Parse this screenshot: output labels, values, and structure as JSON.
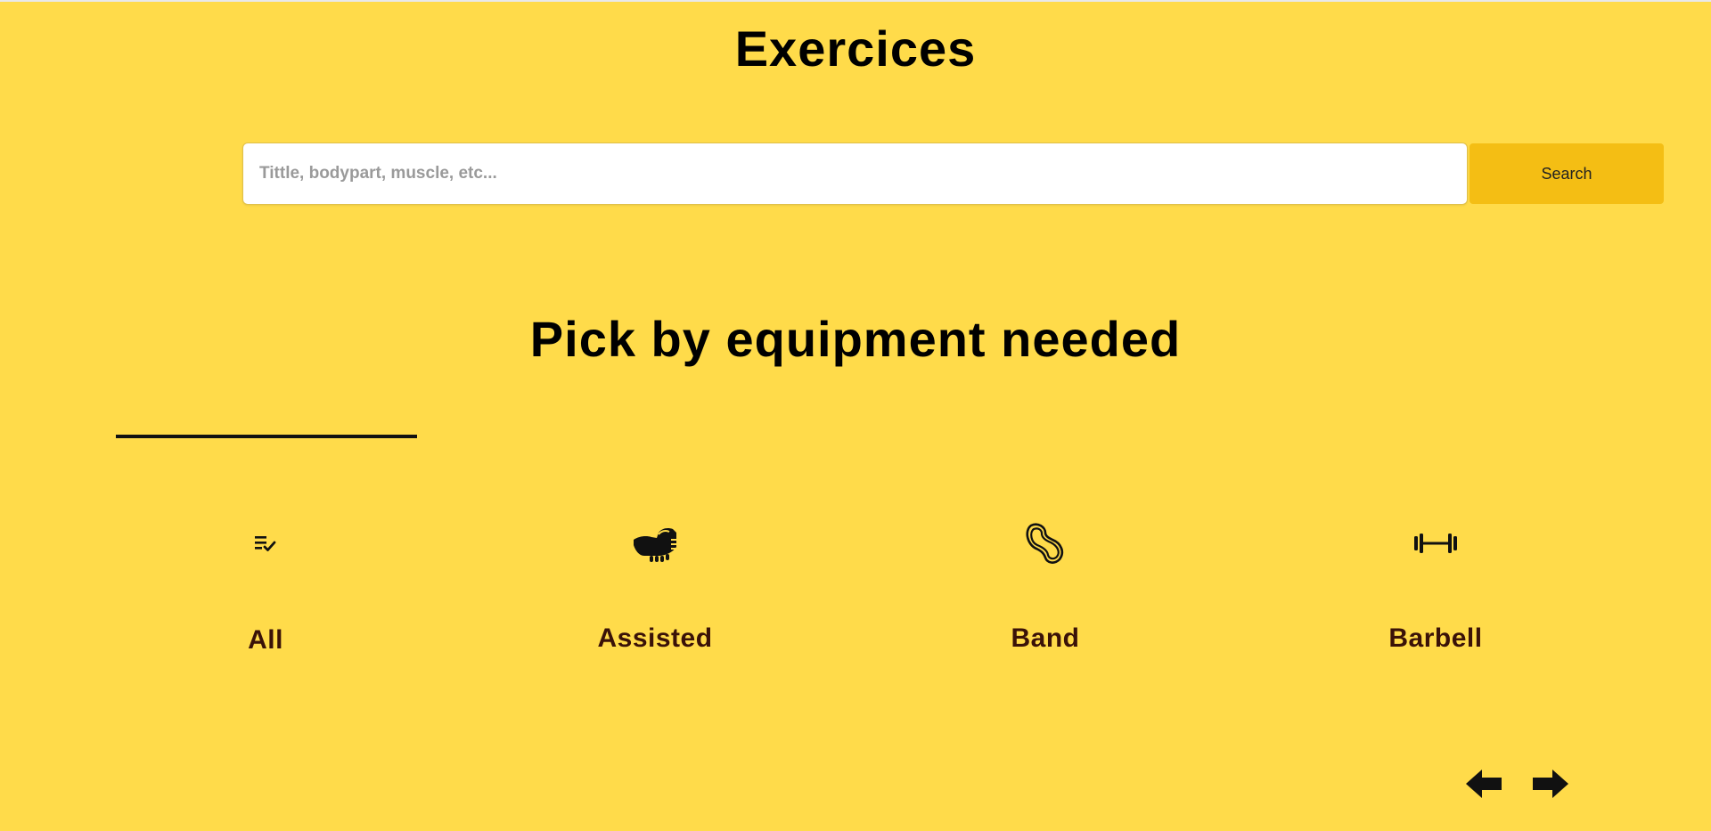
{
  "header": {
    "title": "Exercices"
  },
  "search": {
    "placeholder": "Tittle, bodypart, muscle, etc...",
    "value": "",
    "button_label": "Search"
  },
  "equipment": {
    "heading": "Pick by equipment needed",
    "active_index": 0,
    "items": [
      {
        "label": "All",
        "icon": "checklist-icon"
      },
      {
        "label": "Assisted",
        "icon": "assisted-hand-icon"
      },
      {
        "label": "Band",
        "icon": "resistance-band-icon"
      },
      {
        "label": "Barbell",
        "icon": "barbell-icon"
      }
    ]
  },
  "pagination": {
    "prev_icon": "arrow-left-icon",
    "next_icon": "arrow-right-icon"
  },
  "colors": {
    "background": "#FFDB4A",
    "search_button": "#F4BE14",
    "label_text": "#3a1208"
  }
}
